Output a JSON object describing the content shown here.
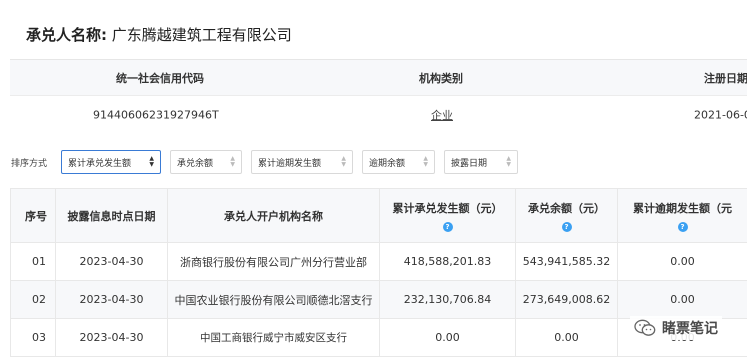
{
  "acceptor": {
    "label": "承兑人名称:",
    "name": "广东腾越建筑工程有限公司"
  },
  "info_table": {
    "headers": [
      "统一社会信用代码",
      "机构类别",
      "注册日期"
    ],
    "values": [
      "91440606231927946T",
      "企业",
      "2021-06-0"
    ]
  },
  "sort": {
    "label": "排序方式",
    "options": [
      "累计承兑发生额",
      "承兑余额",
      "累计逾期发生额",
      "逾期余额",
      "披露日期"
    ],
    "active": "累计承兑发生额"
  },
  "table": {
    "headers": [
      "序号",
      "披露信息时点日期",
      "承兑人开户机构名称",
      "累计承兑发生额（元）",
      "承兑余额（元）",
      "累计逾期发生额（元"
    ],
    "rows": [
      [
        "01",
        "2023-04-30",
        "浙商银行股份有限公司广州分行营业部",
        "418,588,201.83",
        "543,941,585.32",
        "0.00"
      ],
      [
        "02",
        "2023-04-30",
        "中国农业银行股份有限公司顺德北滘支行",
        "232,130,706.84",
        "273,649,008.62",
        "0.00"
      ],
      [
        "03",
        "2023-04-30",
        "中国工商银行威宁市威安区支行",
        "0.00",
        "0.00",
        "0.00"
      ]
    ]
  },
  "watermark": {
    "text": "睹票笔记",
    "icon": "wechat-icon"
  },
  "colors": {
    "accent": "#3a7bd5",
    "help_icon": "#3aa0f2",
    "header_bg": "#f7f8fa"
  }
}
